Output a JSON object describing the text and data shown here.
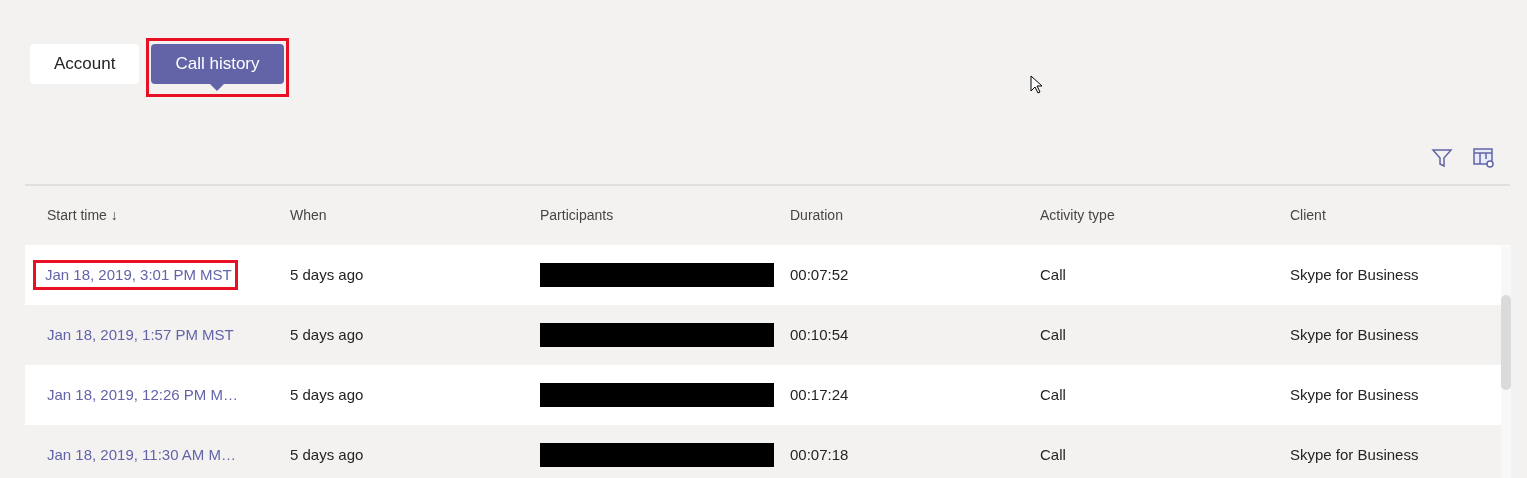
{
  "tabs": [
    {
      "label": "Account",
      "selected": false,
      "highlighted": false
    },
    {
      "label": "Call history",
      "selected": true,
      "highlighted": true
    }
  ],
  "toolbar": {
    "buttons": [
      {
        "kind": "filter"
      },
      {
        "kind": "columns"
      }
    ]
  },
  "table": {
    "columns": [
      {
        "label": "Start time",
        "sort_arrow": "↓"
      },
      {
        "label": "When"
      },
      {
        "label": "Participants"
      },
      {
        "label": "Duration"
      },
      {
        "label": "Activity type"
      },
      {
        "label": "Client"
      }
    ],
    "rows": [
      {
        "start_time": "Jan 18, 2019, 3:01 PM MST",
        "highlighted": true,
        "when": "5 days ago",
        "participants_redacted": true,
        "duration": "00:07:52",
        "activity_type": "Call",
        "client": "Skype for Business"
      },
      {
        "start_time": "Jan 18, 2019, 1:57 PM MST",
        "highlighted": false,
        "when": "5 days ago",
        "participants_redacted": true,
        "duration": "00:10:54",
        "activity_type": "Call",
        "client": "Skype for Business"
      },
      {
        "start_time": "Jan 18, 2019, 12:26 PM M…",
        "highlighted": false,
        "when": "5 days ago",
        "participants_redacted": true,
        "duration": "00:17:24",
        "activity_type": "Call",
        "client": "Skype for Business"
      },
      {
        "start_time": "Jan 18, 2019, 11:30 AM M…",
        "highlighted": false,
        "when": "5 days ago",
        "participants_redacted": true,
        "duration": "00:07:18",
        "activity_type": "Call",
        "client": "Skype for Business"
      }
    ]
  }
}
